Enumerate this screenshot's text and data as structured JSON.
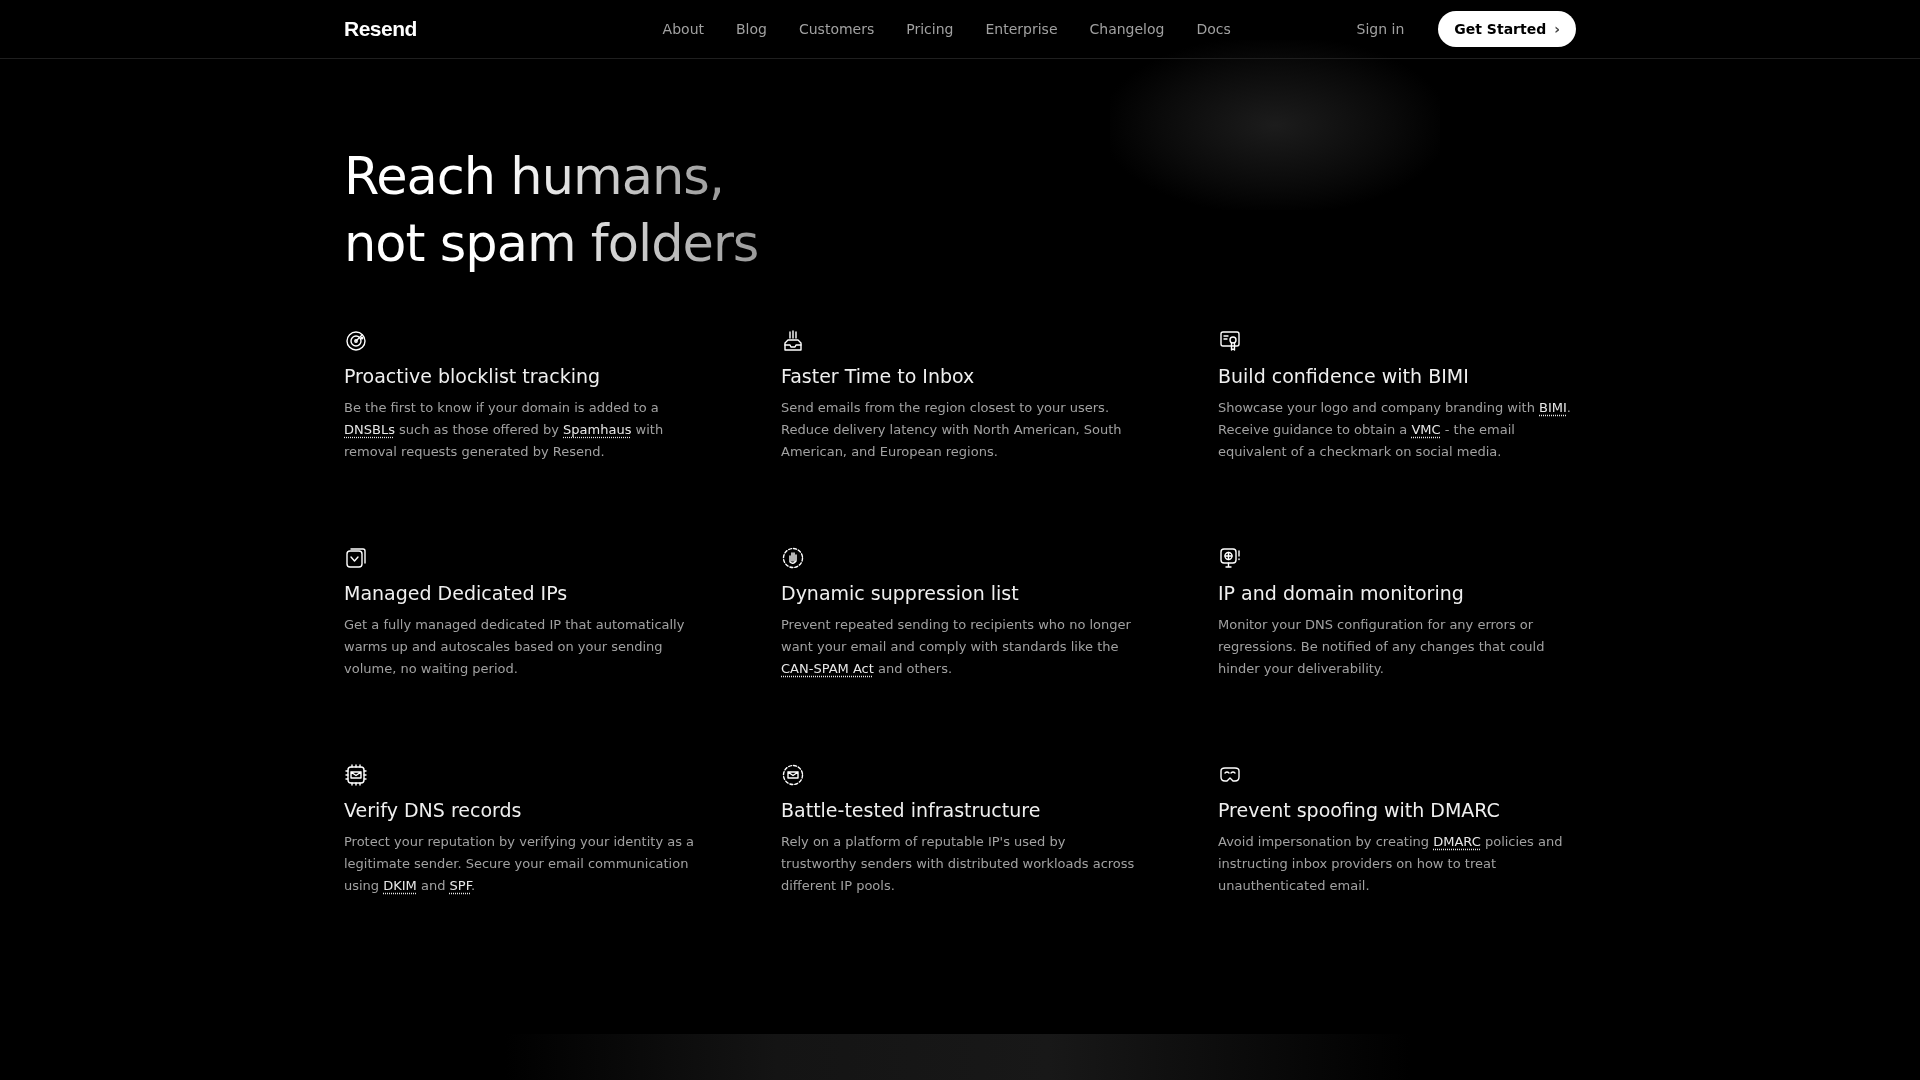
{
  "nav": {
    "logo": "Resend",
    "links": [
      "About",
      "Blog",
      "Customers",
      "Pricing",
      "Enterprise",
      "Changelog",
      "Docs"
    ],
    "sign_in": "Sign in",
    "cta": {
      "label": "Get Started",
      "icon": "›"
    }
  },
  "hero": {
    "lines": [
      "Reach humans,",
      "not spam folders"
    ]
  },
  "features": [
    {
      "title": "Proactive blocklist tracking",
      "description": [
        {
          "kind": "text",
          "text": "Be the first to know if your domain is added to a "
        },
        {
          "kind": "link",
          "text": "DNSBLs"
        },
        {
          "kind": "text",
          "text": " such as those offered by "
        },
        {
          "kind": "link",
          "text": "Spamhaus"
        },
        {
          "kind": "text",
          "text": " with removal requests generated by Resend."
        }
      ]
    },
    {
      "title": "Faster Time to Inbox",
      "description": [
        {
          "kind": "text",
          "text": "Send emails from the region closest to your users. Reduce delivery latency with North American, South American, and European regions."
        }
      ]
    },
    {
      "title": "Build confidence with BIMI",
      "description": [
        {
          "kind": "text",
          "text": "Showcase your logo and company branding with "
        },
        {
          "kind": "link",
          "text": "BIMI"
        },
        {
          "kind": "text",
          "text": ". Receive guidance to obtain a "
        },
        {
          "kind": "link",
          "text": "VMC"
        },
        {
          "kind": "text",
          "text": " - the email equivalent of a checkmark on social media."
        }
      ]
    },
    {
      "title": "Managed Dedicated IPs",
      "description": [
        {
          "kind": "text",
          "text": "Get a fully managed dedicated IP that automatically warms up and autoscales based on your sending volume, no waiting period."
        }
      ]
    },
    {
      "title": "Dynamic suppression list",
      "description": [
        {
          "kind": "text",
          "text": "Prevent repeated sending to recipients who no longer want your email and comply with standards like the "
        },
        {
          "kind": "link",
          "text": "CAN-SPAM Act"
        },
        {
          "kind": "text",
          "text": " and others."
        }
      ]
    },
    {
      "title": "IP and domain monitoring",
      "description": [
        {
          "kind": "text",
          "text": "Monitor your DNS configuration for any errors or regressions. Be notified of any changes that could hinder your deliverability."
        }
      ]
    },
    {
      "title": "Verify DNS records",
      "description": [
        {
          "kind": "text",
          "text": "Protect your reputation by verifying your identity as a legitimate sender. Secure your email communication using "
        },
        {
          "kind": "link",
          "text": "DKIM"
        },
        {
          "kind": "text",
          "text": " and "
        },
        {
          "kind": "link",
          "text": "SPF"
        },
        {
          "kind": "text",
          "text": "."
        }
      ]
    },
    {
      "title": "Battle-tested infrastructure",
      "description": [
        {
          "kind": "text",
          "text": "Rely on a platform of reputable IP's used by trustworthy senders with distributed workloads across different IP pools."
        }
      ]
    },
    {
      "title": "Prevent spoofing with DMARC",
      "description": [
        {
          "kind": "text",
          "text": "Avoid impersonation by creating "
        },
        {
          "kind": "link",
          "text": "DMARC"
        },
        {
          "kind": "text",
          "text": " policies and instructing inbox providers on how to treat unauthenticated email."
        }
      ]
    }
  ]
}
